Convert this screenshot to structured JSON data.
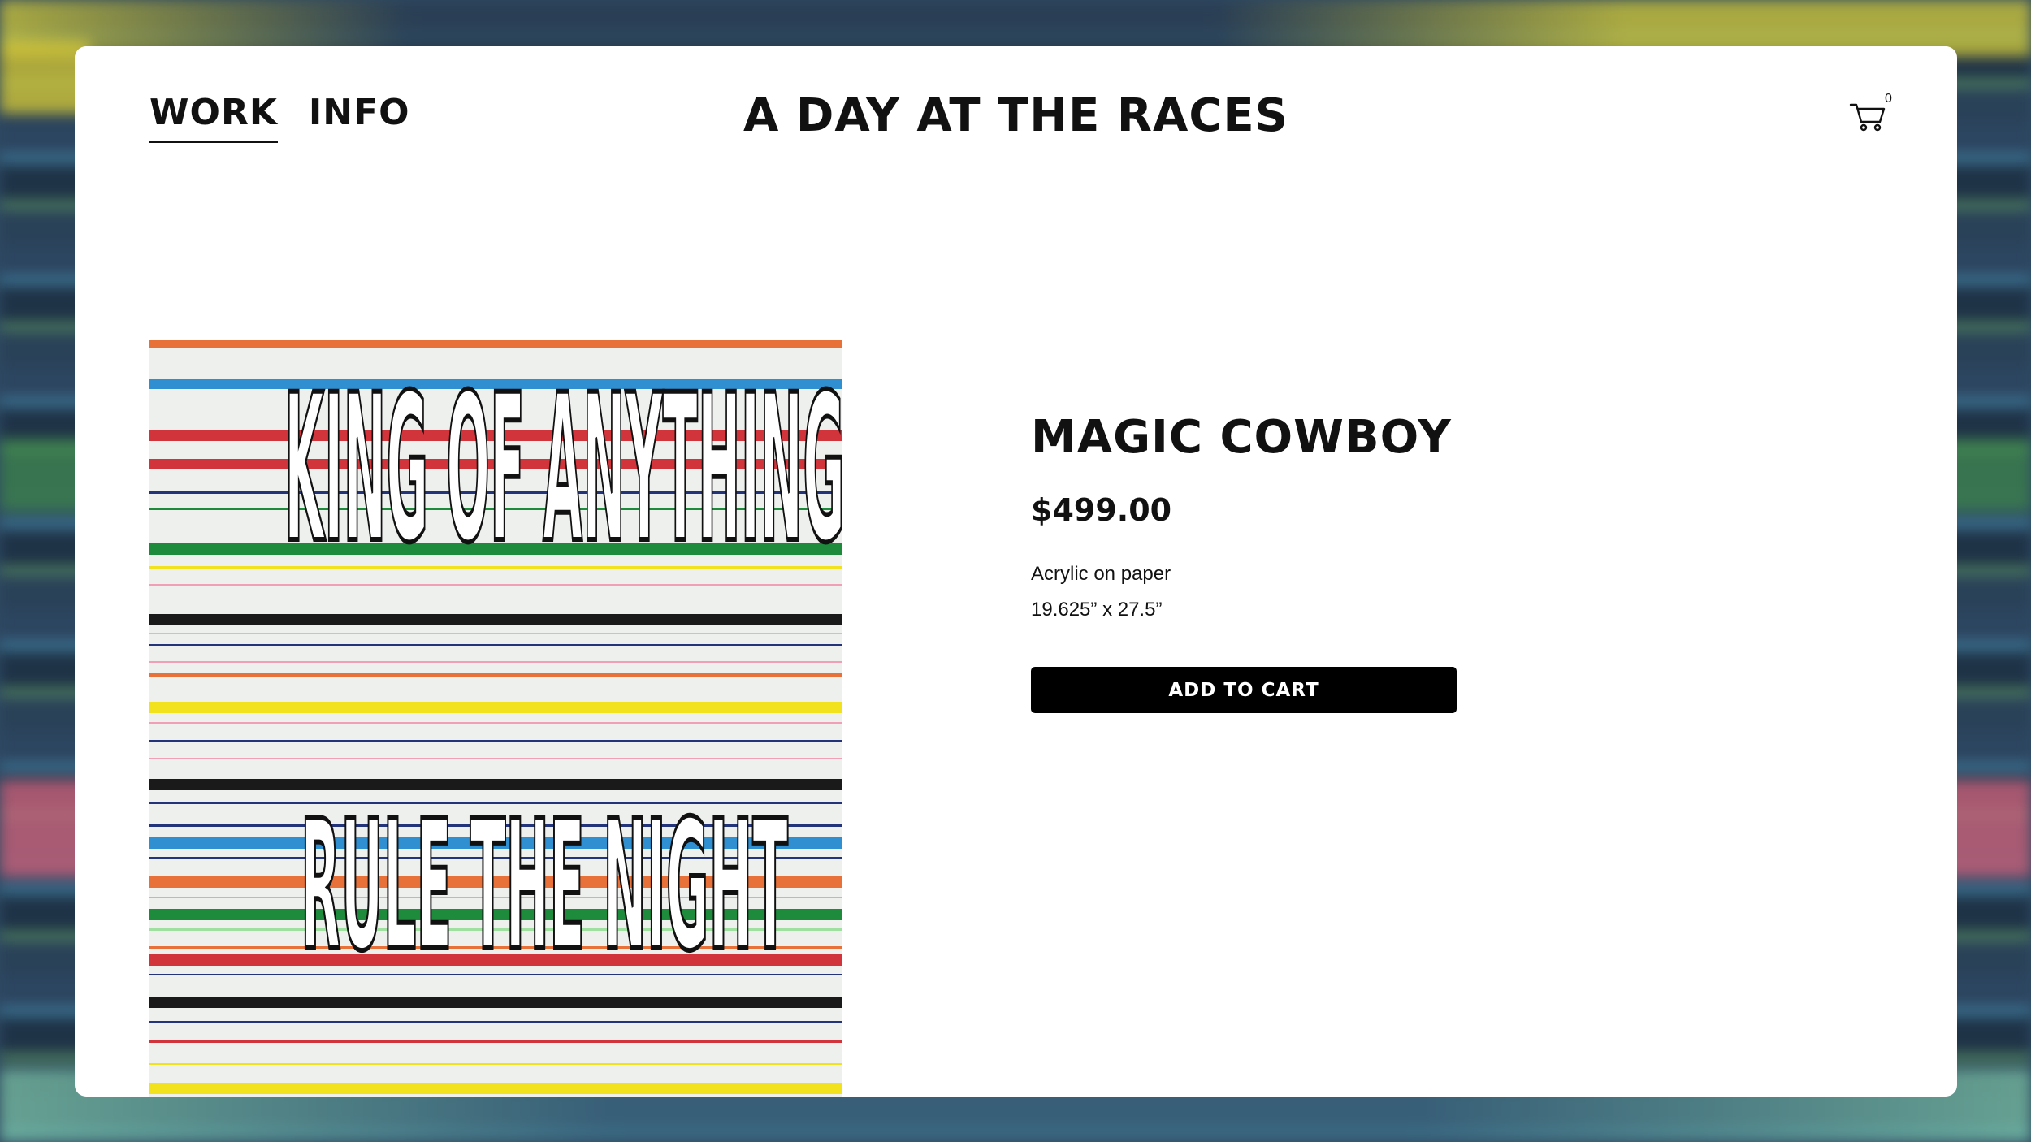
{
  "header": {
    "nav": [
      {
        "label": "WORK",
        "active": true
      },
      {
        "label": "INFO",
        "active": false
      }
    ],
    "site_title": "A DAY AT THE RACES",
    "cart": {
      "icon": "cart-icon",
      "count": "0"
    }
  },
  "product": {
    "title": "MAGIC COWBOY",
    "price": "$499.00",
    "medium": "Acrylic on paper",
    "dimensions": "19.625” x 27.5”",
    "add_to_cart_label": "ADD TO CART"
  },
  "artwork": {
    "text_line_1": "KING OF ANYTHING",
    "text_line_2": "RULE THE NIGHT",
    "stripe_colors": [
      "#e8713a",
      "#2f8fd0",
      "#d2343b",
      "#1e8a3c",
      "#1a1a1a",
      "#f2e21d",
      "#24347a",
      "#f19fb6",
      "#9fe0a0"
    ]
  },
  "colors": {
    "accent": "#000000",
    "page_background": "#ffffff"
  }
}
